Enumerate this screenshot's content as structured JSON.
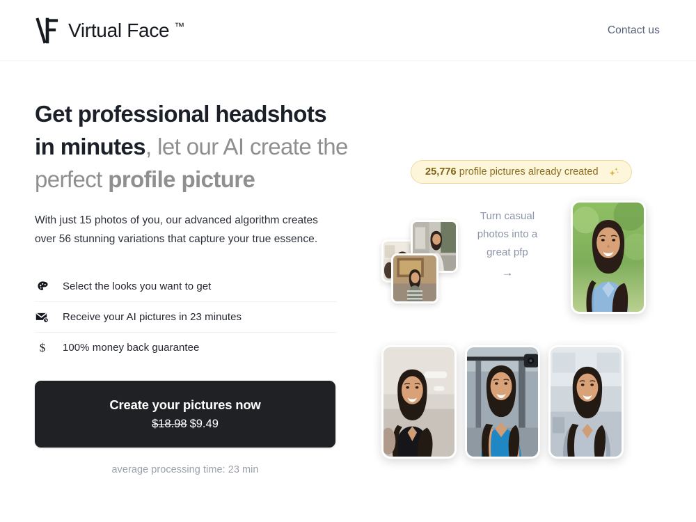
{
  "header": {
    "logo_icon": "vf-monogram-logo",
    "brand_name": "Virtual Face",
    "brand_trademark": "™",
    "contact_label": "Contact us"
  },
  "hero": {
    "headline": {
      "bold_1": "Get professional headshots in minutes",
      "muted_1": ", let our AI create the perfect ",
      "muted_bold_1": "profile picture"
    },
    "subtitle": "With just 15 photos of you, our advanced algorithm creates over 56 stunning variations that capture your true essence.",
    "features": [
      {
        "icon": "palette-icon",
        "label": "Select the looks you want to get"
      },
      {
        "icon": "envelope-clock-icon",
        "label": "Receive your AI pictures in 23 minutes"
      },
      {
        "icon": "dollar-icon",
        "label": "100% money back guarantee",
        "glyph": "$"
      }
    ],
    "cta": {
      "title": "Create your pictures now",
      "old_price": "$18.98",
      "new_price": "$9.49",
      "note": "average processing time: 23 min"
    }
  },
  "showcase": {
    "badge": {
      "count": "25,776",
      "text": " profile pictures already created",
      "icon": "sparkles-icon",
      "background": "#FDF6DA",
      "border": "#EDD9A0",
      "text_color": "#8A6D1F"
    },
    "conversion_caption": "Turn casual photos into a great pfp",
    "conversion_arrow": "→",
    "input_photos": [
      {
        "name": "casual-photo-indoor-kitchen",
        "alt": "Woman in white shirt indoors"
      },
      {
        "name": "casual-photo-outdoor-street",
        "alt": "Woman in white top on a street"
      },
      {
        "name": "casual-photo-sofa-striped",
        "alt": "Woman in striped top on a sofa"
      }
    ],
    "result_photos": [
      {
        "name": "headshot-outdoor-blue-polo",
        "alt": "Headshot outdoors in blue polo, green foliage background"
      },
      {
        "name": "headshot-office-black-top",
        "alt": "Headshot in black top, bright office background"
      },
      {
        "name": "headshot-gym-blue-tank",
        "alt": "Headshot in blue tank top at the gym"
      },
      {
        "name": "headshot-office-grey-blazer",
        "alt": "Headshot in grey blazer, office background"
      }
    ]
  }
}
